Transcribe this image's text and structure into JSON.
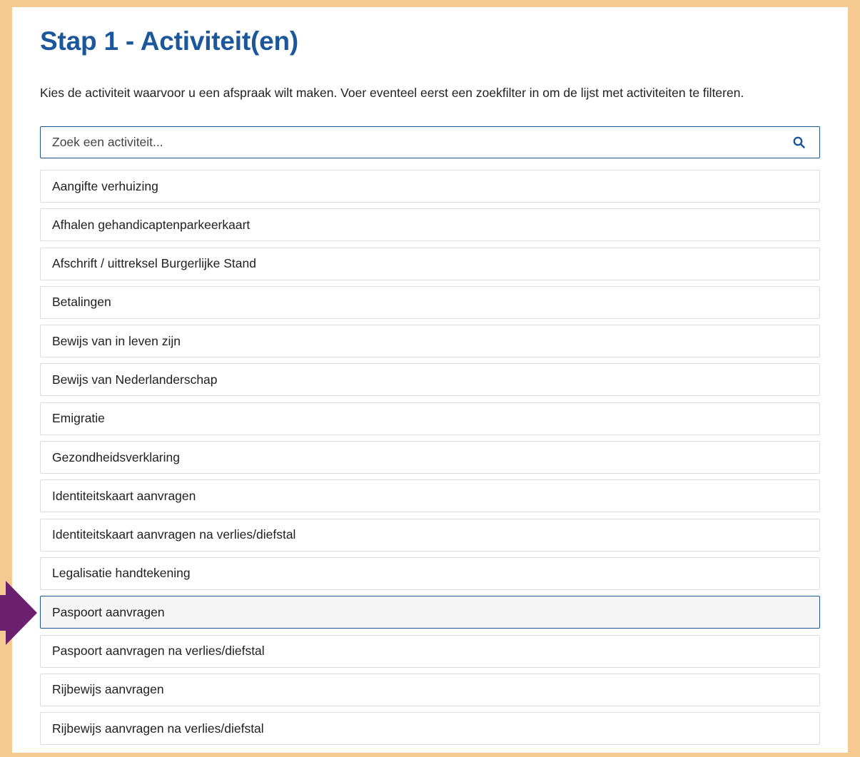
{
  "header": {
    "title": "Stap 1 - Activiteit(en)",
    "intro": "Kies de activiteit waarvoor u een afspraak wilt maken. Voer eventeel eerst een zoekfilter in om de lijst met activiteiten te filteren."
  },
  "search": {
    "placeholder": "Zoek een activiteit...",
    "value": "",
    "icon": "search-icon"
  },
  "activities": [
    "Aangifte verhuizing",
    "Afhalen gehandicaptenparkeerkaart",
    "Afschrift / uittreksel Burgerlijke Stand",
    "Betalingen",
    "Bewijs van in leven zijn",
    "Bewijs van Nederlanderschap",
    "Emigratie",
    "Gezondheidsverklaring",
    "Identiteitskaart aanvragen",
    "Identiteitskaart aanvragen na verlies/diefstal",
    "Legalisatie handtekening",
    "Paspoort aanvragen",
    "Paspoort aanvragen na verlies/diefstal",
    "Rijbewijs aanvragen",
    "Rijbewijs aanvragen na verlies/diefstal"
  ],
  "selected_activity": "Paspoort aanvragen",
  "colors": {
    "frame": "#f5c990",
    "title": "#1d579b",
    "selected_border": "#1d579b",
    "arrow": "#6b2170"
  }
}
